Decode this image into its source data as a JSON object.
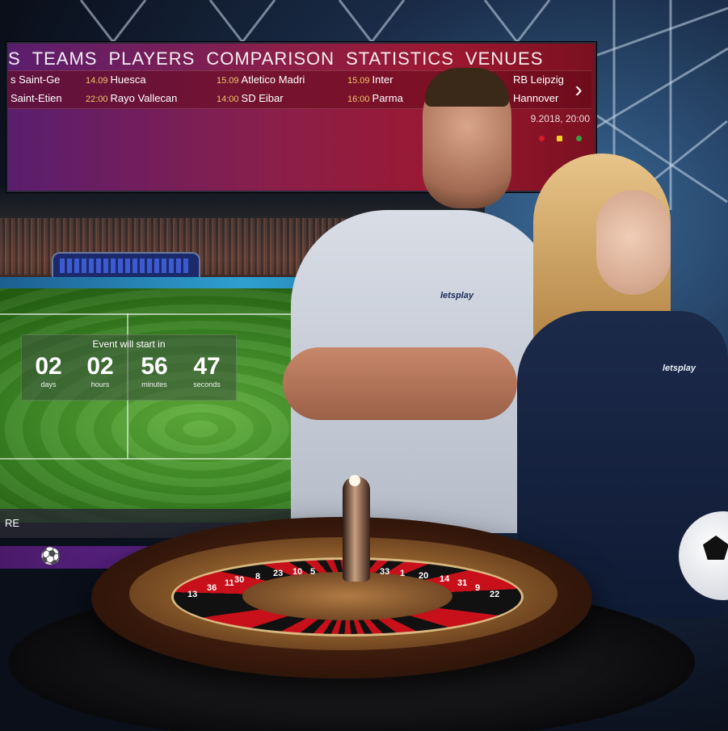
{
  "menu": [
    "S",
    "TEAMS",
    "PLAYERS",
    "COMPARISON",
    "STATISTICS",
    "VENUES"
  ],
  "fixtures": [
    {
      "d1": "",
      "t1": "s Saint-Ge",
      "d2": "",
      "t2": "Saint-Etien"
    },
    {
      "d1": "14.09",
      "t1": "Huesca",
      "d2": "22:00",
      "t2": "Rayo Vallecan"
    },
    {
      "d1": "15.09",
      "t1": "Atletico Madri",
      "d2": "14:00",
      "t2": "SD Eibar"
    },
    {
      "d1": "15.09",
      "t1": "Inter",
      "d2": "16:00",
      "t2": "Parma"
    },
    {
      "d1": "",
      "t1": "RB Leipzig",
      "d2": "",
      "t2": "Hannover"
    }
  ],
  "next_icon": "chevron-right-icon",
  "event_datetime": "9.2018, 20:00",
  "countdown": {
    "title": "Event will start in",
    "days": {
      "value": "02",
      "label": "days"
    },
    "hours": {
      "value": "02",
      "label": "hours"
    },
    "minutes": {
      "value": "56",
      "label": "minutes"
    },
    "seconds": {
      "value": "47",
      "label": "seconds"
    }
  },
  "bottom_bar_label": "RE",
  "bottom_icon": "soccer-ball-icon",
  "brand_logo": "letsplay",
  "roulette_numbers_left": [
    "13",
    "36",
    "11",
    "30",
    "8",
    "23",
    "10",
    "5"
  ],
  "roulette_numbers_right": [
    "33",
    "1",
    "20",
    "14",
    "31",
    "9",
    "22"
  ],
  "colors": {
    "panel_red": "#9c1830",
    "panel_purple": "#5a1e6e",
    "date_gold": "#f2c46a"
  }
}
